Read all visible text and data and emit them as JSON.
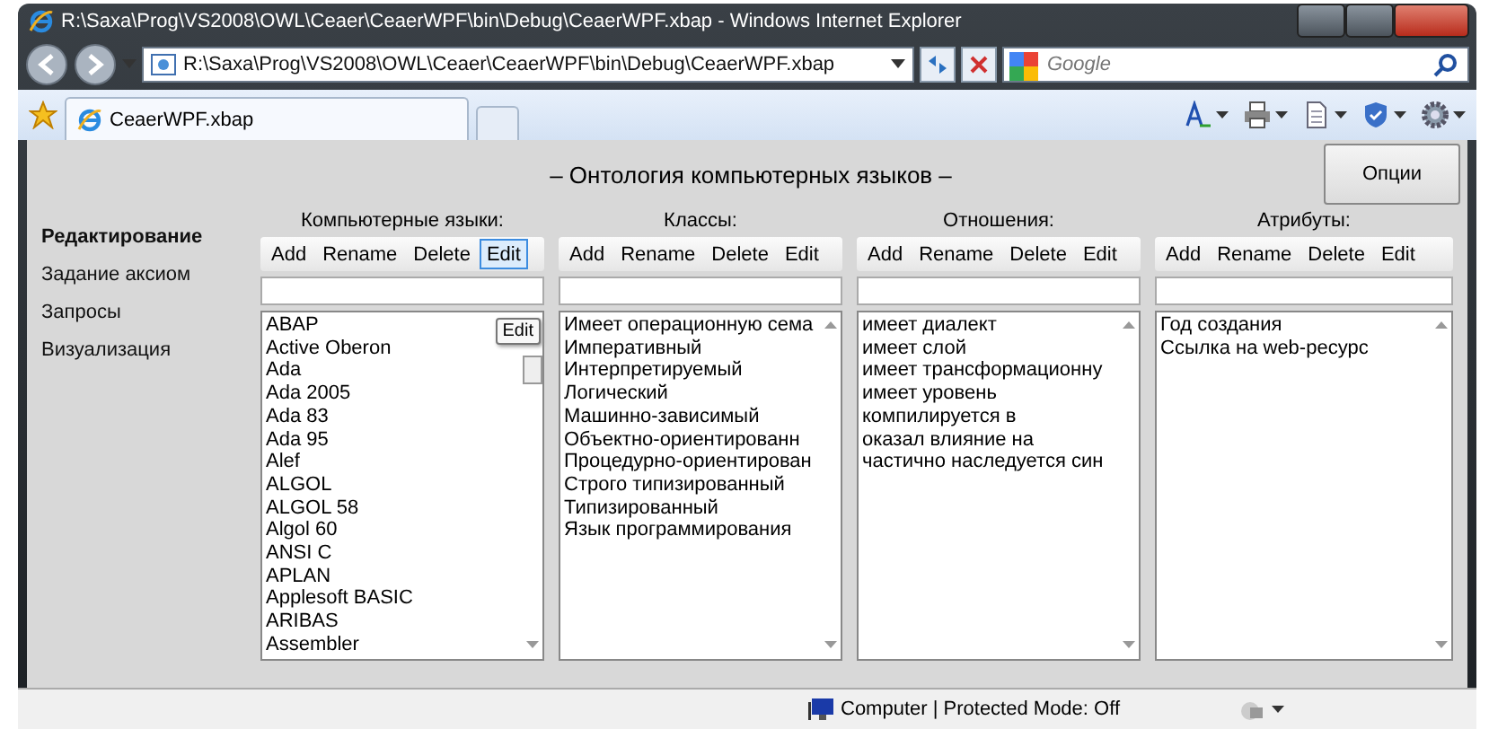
{
  "window": {
    "title": "R:\\Saxa\\Prog\\VS2008\\OWL\\Ceaer\\CeaerWPF\\bin\\Debug\\CeaerWPF.xbap - Windows Internet Explorer"
  },
  "address_bar": {
    "url": "R:\\Saxa\\Prog\\VS2008\\OWL\\Ceaer\\CeaerWPF\\bin\\Debug\\CeaerWPF.xbap"
  },
  "search": {
    "placeholder": "Google"
  },
  "tabs": [
    {
      "label": "CeaerWPF.xbap",
      "selected": true
    }
  ],
  "app": {
    "title": "– Онтология компьютерных языков –",
    "options_button": "Опции",
    "nav": [
      {
        "label": "Редактирование",
        "selected": true
      },
      {
        "label": "Задание аксиом",
        "selected": false
      },
      {
        "label": "Запросы",
        "selected": false
      },
      {
        "label": "Визуализация",
        "selected": false
      }
    ],
    "panels": [
      {
        "label": "Компьютерные языки:",
        "buttons": [
          {
            "label": "Add",
            "hovered": false
          },
          {
            "label": "Rename",
            "hovered": false
          },
          {
            "label": "Delete",
            "hovered": false
          },
          {
            "label": "Edit",
            "hovered": true
          }
        ],
        "tooltip": "Edit",
        "items": [
          "ABAP",
          "Active Oberon",
          "Ada",
          "Ada 2005",
          "Ada 83",
          "Ada 95",
          "Alef",
          "ALGOL",
          "ALGOL 58",
          "Algol 60",
          "ANSI C",
          "APLAN",
          "Applesoft BASIC",
          "ARIBAS",
          "Assembler"
        ]
      },
      {
        "label": "Классы:",
        "buttons": [
          {
            "label": "Add",
            "hovered": false
          },
          {
            "label": "Rename",
            "hovered": false
          },
          {
            "label": "Delete",
            "hovered": false
          },
          {
            "label": "Edit",
            "hovered": false
          }
        ],
        "items": [
          "Имеет операционную сема",
          "Императивный",
          "Интерпретируемый",
          "Логический",
          "Машинно-зависимый",
          "Объектно-ориентированн",
          "Процедурно-ориентирован",
          "Строго типизированный",
          "Типизированный",
          "Язык программирования"
        ]
      },
      {
        "label": "Отношения:",
        "buttons": [
          {
            "label": "Add",
            "hovered": false
          },
          {
            "label": "Rename",
            "hovered": false
          },
          {
            "label": "Delete",
            "hovered": false
          },
          {
            "label": "Edit",
            "hovered": false
          }
        ],
        "items": [
          "имеет диалект",
          "имеет слой",
          "имеет трансформационну",
          "имеет уровень",
          "компилируется в",
          "оказал влияние на",
          "частично наследуется син"
        ]
      },
      {
        "label": "Атрибуты:",
        "buttons": [
          {
            "label": "Add",
            "hovered": false
          },
          {
            "label": "Rename",
            "hovered": false
          },
          {
            "label": "Delete",
            "hovered": false
          },
          {
            "label": "Edit",
            "hovered": false
          }
        ],
        "items": [
          "Год создания",
          "Ссылка на web-ресурс"
        ]
      }
    ]
  },
  "status_bar": {
    "zone": "Computer | Protected Mode: Off"
  }
}
